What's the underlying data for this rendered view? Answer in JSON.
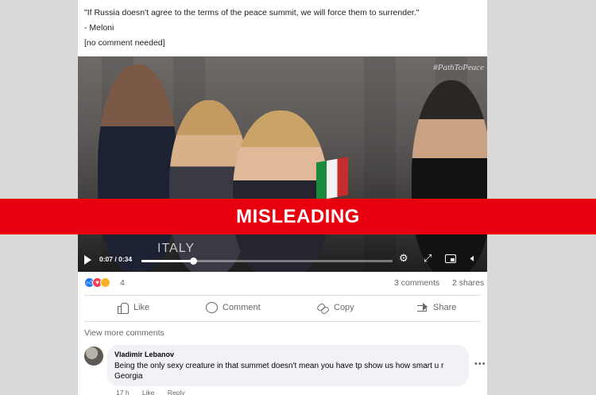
{
  "post": {
    "caption_lines": [
      "\"If Russia doesn't agree to the terms of the peace summit, we will force them to surrender.\"",
      "- Meloni",
      "[no comment needed]"
    ]
  },
  "video": {
    "hashtag_overlay": "#PathToPeace",
    "caption_overlay": "ITALY",
    "time": "0:07 / 0:34",
    "progress": 0.206,
    "icons": [
      "play-icon",
      "gear-icon",
      "expand-icon",
      "pip-icon",
      "volume-icon"
    ]
  },
  "banner": {
    "label": "MISLEADING",
    "color": "#e8000f"
  },
  "stats": {
    "reaction_count": "4",
    "comments": "3 comments",
    "shares": "2 shares",
    "reaction_icons": [
      "like-reaction-icon",
      "love-reaction-icon",
      "haha-reaction-icon"
    ]
  },
  "actions": {
    "like": "Like",
    "comment": "Comment",
    "copy": "Copy",
    "share": "Share"
  },
  "comments_section": {
    "view_more": "View more comments",
    "comment": {
      "author": "Vladimir Lebanov",
      "text": "Being the only sexy creature in that summet doesn't mean you have tp show us how smart u r Georgia",
      "time": "17 h",
      "like": "Like",
      "reply": "Reply"
    }
  },
  "colors": {
    "accent_blue": "#1877f2",
    "banner_red": "#e8000f",
    "background": "#d9d9da"
  }
}
